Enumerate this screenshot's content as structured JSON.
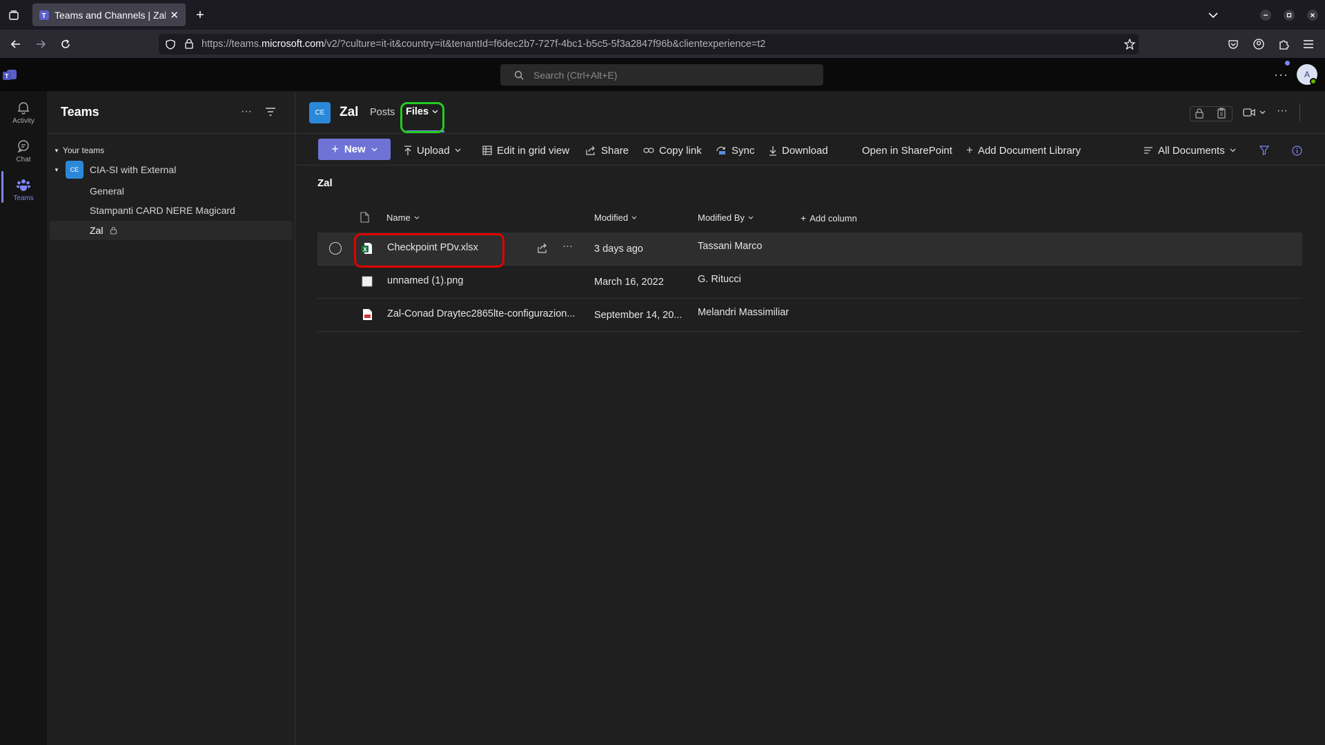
{
  "browser": {
    "tab_title": "Teams and Channels | Zal",
    "url_prefix": "https://teams.",
    "url_domain": "microsoft.com",
    "url_rest": "/v2/?culture=it-it&country=it&tenantId=f6dec2b7-727f-4bc1-b5c5-5f3a2847f96b&clientexperience=t2"
  },
  "header": {
    "search_placeholder": "Search (Ctrl+Alt+E)",
    "avatar_initial": "A"
  },
  "rail": {
    "items": [
      {
        "label": "Activity"
      },
      {
        "label": "Chat"
      },
      {
        "label": "Teams"
      }
    ]
  },
  "teams_pane": {
    "title": "Teams",
    "section_label": "Your teams",
    "team_badge": "CE",
    "team_name": "CIA-SI with External",
    "channels": [
      "General",
      "Stampanti CARD NERE Magicard",
      "Zal"
    ]
  },
  "channel": {
    "badge": "CE",
    "name": "Zal",
    "tabs": [
      "Posts",
      "Files"
    ]
  },
  "commands": {
    "new": "New",
    "upload": "Upload",
    "edit_grid": "Edit in grid view",
    "share": "Share",
    "copy_link": "Copy link",
    "sync": "Sync",
    "download": "Download",
    "open_sharepoint": "Open in SharePoint",
    "add_library": "Add Document Library",
    "view": "All Documents"
  },
  "library": {
    "breadcrumb": "Zal",
    "columns": {
      "name": "Name",
      "modified": "Modified",
      "modified_by": "Modified By",
      "add_column": "Add column"
    },
    "files": [
      {
        "name": "Checkpoint PDv.xlsx",
        "modified": "3 days ago",
        "modified_by": "Tassani Marco",
        "type": "excel"
      },
      {
        "name": "unnamed (1).png",
        "modified": "March 16, 2022",
        "modified_by": "G. Ritucci",
        "type": "image"
      },
      {
        "name": "Zal-Conad Draytec2865lte-configurazion...",
        "modified": "September 14, 20...",
        "modified_by": "Melandri Massimiliar",
        "type": "pdf"
      }
    ]
  },
  "colors": {
    "accent": "#7073d6",
    "highlight_red": "#e00000",
    "highlight_green": "#22cc22"
  }
}
